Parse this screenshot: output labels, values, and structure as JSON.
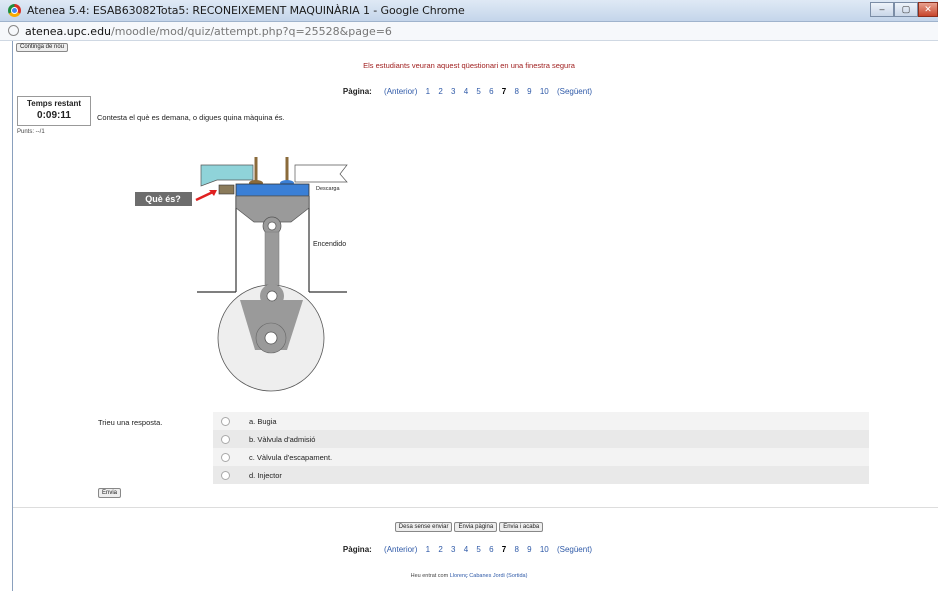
{
  "window": {
    "title": "Atenea 5.4: ESAB63082Tota5: RECONEIXEMENT MAQUINÀRIA 1 - Google Chrome",
    "buttons": [
      "–",
      "▢",
      "✕"
    ]
  },
  "address": {
    "host": "atenea.upc.edu",
    "path": "/moodle/mod/quiz/attempt.php?q=25528&page=6"
  },
  "skip_button": "Continga de nou",
  "secure_message": "Els estudiants veuran aquest qüestionari en una finestra segura",
  "pager": {
    "label": "Pàgina:",
    "prev": "(Anterior)",
    "pages": [
      "1",
      "2",
      "3",
      "4",
      "5",
      "6",
      "7",
      "8",
      "9",
      "10"
    ],
    "current": "7",
    "next": "(Següent)"
  },
  "timer": {
    "label": "Temps restant",
    "value": "0:09:11"
  },
  "score": "Punts: --/1",
  "question": "Contesta el què es demana, o digues quina màquina és.",
  "diagram": {
    "callout": "Què és?",
    "label_discharge": "Descarga",
    "label_ignition": "Encendido",
    "colors": {
      "callout_bg": "#6d6d6d",
      "arrow": "#e02020",
      "intake": "#8fd3d9",
      "head": "#3a7fd6",
      "part": "#8a7a5a",
      "metal": "#9a9a9a"
    }
  },
  "answers": {
    "prompt": "Trieu una resposta.",
    "options": [
      "a. Bugia",
      "b. Vàlvula d'admisió",
      "c. Vàlvula d'escapament.",
      "d. Injector"
    ]
  },
  "send_button": "Envia",
  "footer_buttons": [
    "Desa sense enviar",
    "Envia pàgina",
    "Envia i acaba"
  ],
  "login": {
    "prefix": "Heu entrat com",
    "user": "Llorenç Cabanes Jordi",
    "logout": "(Sortida)"
  }
}
